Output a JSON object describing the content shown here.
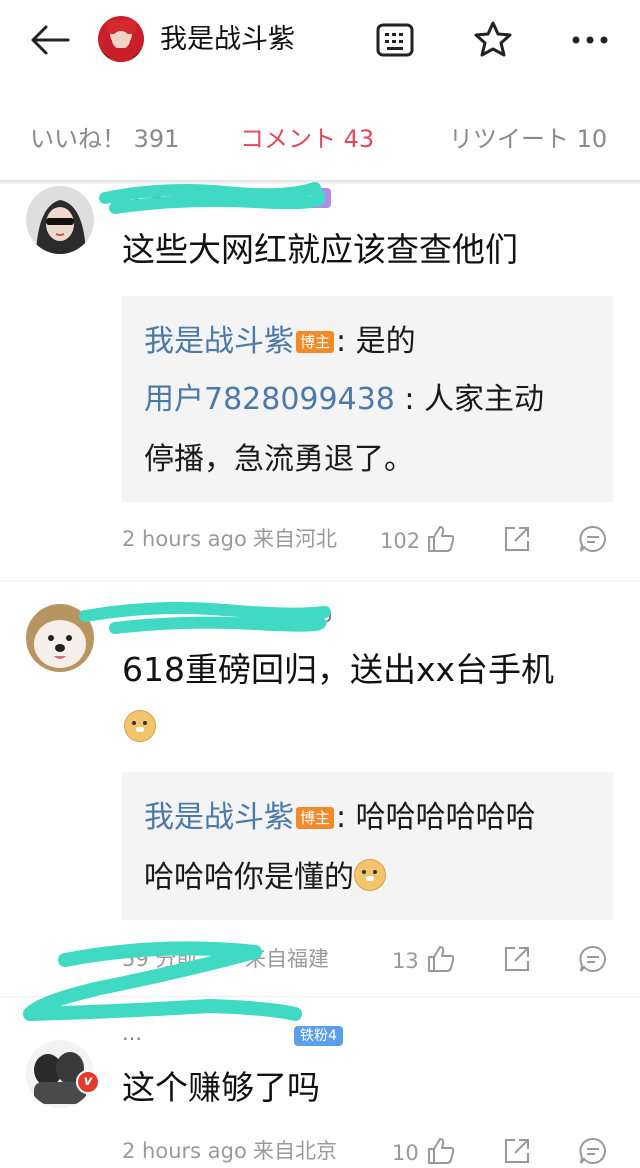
{
  "header": {
    "title": "我是战斗紫"
  },
  "tabs": {
    "like": "いいね！ 391",
    "comment": "コメント 43",
    "retweet": "リツイート 10"
  },
  "colors": {
    "accent": "#e0485b",
    "link": "#4b79a8",
    "author_badge": "#f08a2a",
    "scribble": "#3fd9c4"
  },
  "comments": [
    {
      "name": "我是…",
      "fan_badge": "钻粉1",
      "text": "这些大网红就应该查查他们",
      "replies": [
        {
          "author": "我是战斗紫",
          "author_badge": "博主",
          "text": ": 是的"
        },
        {
          "author": "用户7828099438",
          "text": " : 人家主动",
          "text_cont": "停播，急流勇退了。"
        }
      ],
      "time": "2 hours ago",
      "location": "来自河北",
      "likes": "102"
    },
    {
      "name": "…to",
      "text": "618重磅回归，送出xx台手机",
      "emoji": "doge",
      "replies": [
        {
          "author": "我是战斗紫",
          "author_badge": "博主",
          "text": ": 哈哈哈哈哈哈",
          "text_cont": "哈哈哈你是懂的"
        }
      ],
      "time": "59 分前",
      "location": "来自福建",
      "likes": "13"
    },
    {
      "name": "…",
      "fan_badge": "铁粉4",
      "text": "这个赚够了吗",
      "time": "2 hours ago",
      "location": "来自北京",
      "likes": "10"
    }
  ]
}
